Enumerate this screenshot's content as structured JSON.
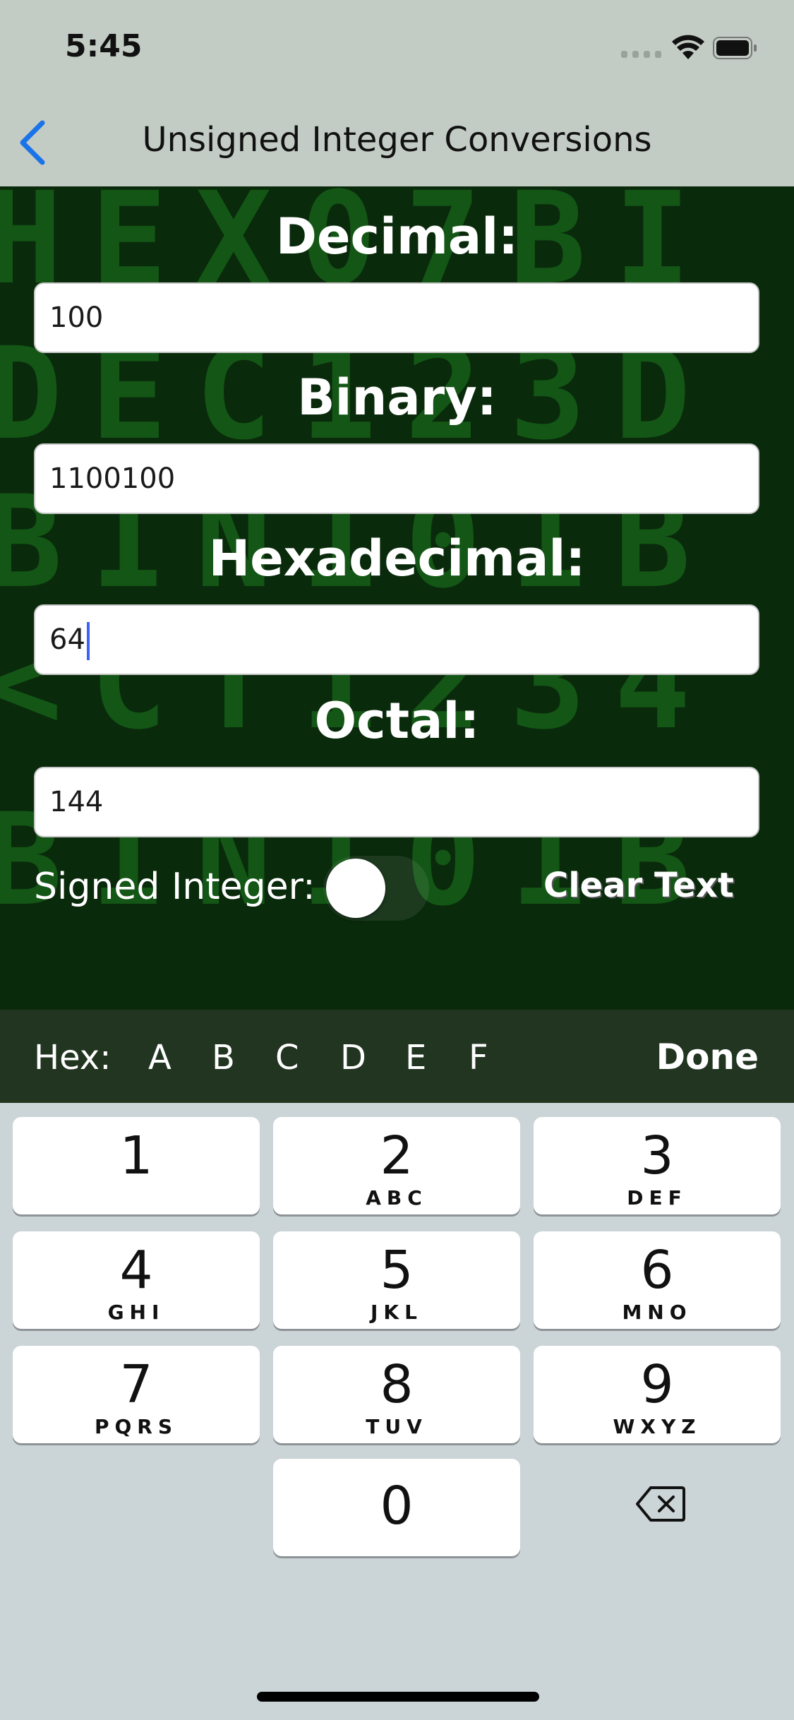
{
  "status_bar": {
    "time": "5:45"
  },
  "nav": {
    "title": "Unsigned Integer Conversions"
  },
  "background_letters": [
    "HEX07BI",
    "<CT1234",
    "DEC123D",
    "BIN101B"
  ],
  "fields": {
    "decimal": {
      "label": "Decimal:",
      "value": "100"
    },
    "binary": {
      "label": "Binary:",
      "value": "1100100"
    },
    "hexadecimal": {
      "label": "Hexadecimal:",
      "value": "64"
    },
    "octal": {
      "label": "Octal:",
      "value": "144"
    }
  },
  "signed": {
    "label": "Signed Integer:",
    "on": false
  },
  "clear_label": "Clear Text",
  "hexbar": {
    "label": "Hex:",
    "keys": [
      "A",
      "B",
      "C",
      "D",
      "E",
      "F"
    ],
    "done": "Done"
  },
  "keypad": [
    {
      "num": "1",
      "letters": ""
    },
    {
      "num": "2",
      "letters": "ABC"
    },
    {
      "num": "3",
      "letters": "DEF"
    },
    {
      "num": "4",
      "letters": "GHI"
    },
    {
      "num": "5",
      "letters": "JKL"
    },
    {
      "num": "6",
      "letters": "MNO"
    },
    {
      "num": "7",
      "letters": "PQRS"
    },
    {
      "num": "8",
      "letters": "TUV"
    },
    {
      "num": "9",
      "letters": "WXYZ"
    },
    {
      "num": "0",
      "letters": ""
    }
  ],
  "icons": {
    "back": "chevron-left-icon",
    "delete": "backspace-icon",
    "wifi": "wifi-icon",
    "battery": "battery-icon",
    "signal": "cellular-signal-icon"
  },
  "colors": {
    "accent": "#1a73e8",
    "background": "#0a2a0c",
    "pattern": "#145b17",
    "hexbar": "#213521"
  }
}
